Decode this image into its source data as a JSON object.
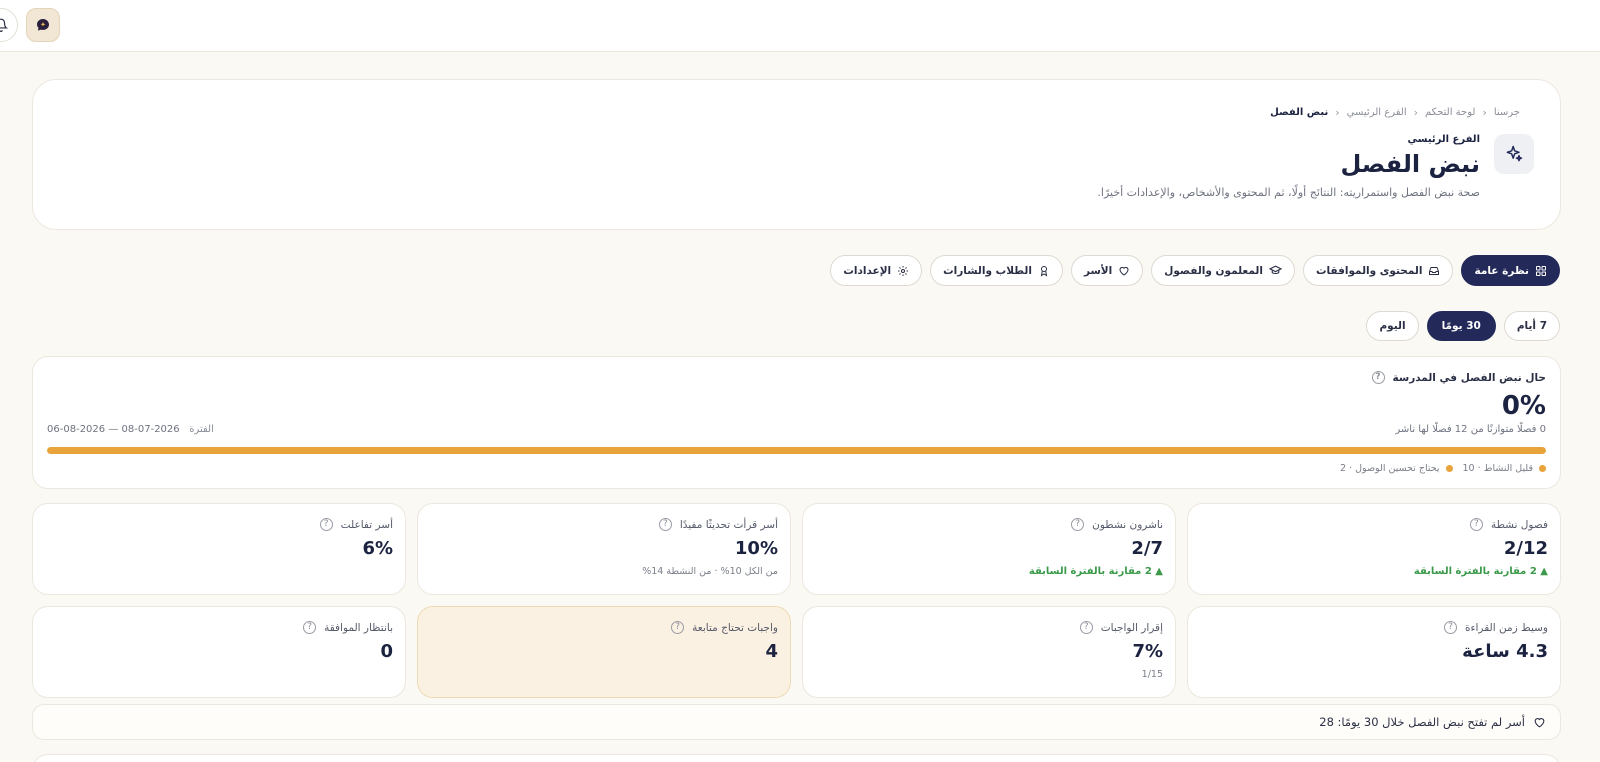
{
  "topbar": {
    "bell_icon": "bell-icon",
    "chat_icon": "chat-sparkle-icon"
  },
  "breadcrumb": [
    "جرسنا",
    "لوحة التحكم",
    "الفرع الرئيسي",
    "نبض الفصل"
  ],
  "header": {
    "icon": "sparkle-icon",
    "subtitle": "الفرع الرئيسي",
    "title": "نبض الفصل",
    "description": "صحة نبض الفصل واستمراريته: النتائج أولًا، ثم المحتوى والأشخاص، والإعدادات أخيرًا."
  },
  "tabs": [
    {
      "label": "نظرة عامة",
      "icon": "grid-icon",
      "active": true
    },
    {
      "label": "المحتوى والموافقات",
      "icon": "inbox-icon",
      "active": false
    },
    {
      "label": "المعلمون والفصول",
      "icon": "graduation-cap-icon",
      "active": false
    },
    {
      "label": "الأسر",
      "icon": "heart-icon",
      "active": false
    },
    {
      "label": "الطلاب والشارات",
      "icon": "award-icon",
      "active": false
    },
    {
      "label": "الإعدادات",
      "icon": "gear-icon",
      "active": false
    }
  ],
  "periods": [
    {
      "label": "7 أيام",
      "active": false
    },
    {
      "label": "30 يومًا",
      "active": true
    },
    {
      "label": "اليوم",
      "active": false
    }
  ],
  "pulse": {
    "title": "حال نبض الفصل في المدرسة",
    "value": "0%",
    "progress": 1.0,
    "note": "0 فصلًا متوازنًا من 12 فصلًا لها ناشر",
    "range_label": "الفترة",
    "range_value": "2026-07-08 — 2026-08-06",
    "legend": [
      {
        "text": "قليل النشاط · 10"
      },
      {
        "text": "يحتاج تحسين الوصول · 2"
      }
    ],
    "bar_color": "#e8a33b"
  },
  "metrics_row1": [
    {
      "title": "فصول نشطة",
      "value": "2/12",
      "trend": "▲ 2 مقارنة بالفترة السابقة"
    },
    {
      "title": "ناشرون نشطون",
      "value": "2/7",
      "trend": "▲ 2 مقارنة بالفترة السابقة"
    },
    {
      "title": "أسر قرأت تحديثًا مفيدًا",
      "value": "10%",
      "note": "من الكل 10% · من النشطة 14%"
    },
    {
      "title": "أسر تفاعلت",
      "value": "6%"
    }
  ],
  "metrics_row2": [
    {
      "title": "وسيط زمن القراءة",
      "value": "4.3 ساعة"
    },
    {
      "title": "إقرار الواجبات",
      "value": "7%",
      "note": "1/15"
    },
    {
      "title": "واجبات تحتاج متابعة",
      "value": "4",
      "warning": true
    },
    {
      "title": "بانتظار الموافقة",
      "value": "0"
    }
  ],
  "families_notice": {
    "icon": "heart-icon",
    "text": "أسر لم تفتح نبض الفصل خلال 30 يومًا: 28"
  },
  "colors": {
    "accent": "#232a5a",
    "warning": "#e8a33b",
    "positive": "#3b9a4a",
    "background": "#fbf9f4"
  }
}
